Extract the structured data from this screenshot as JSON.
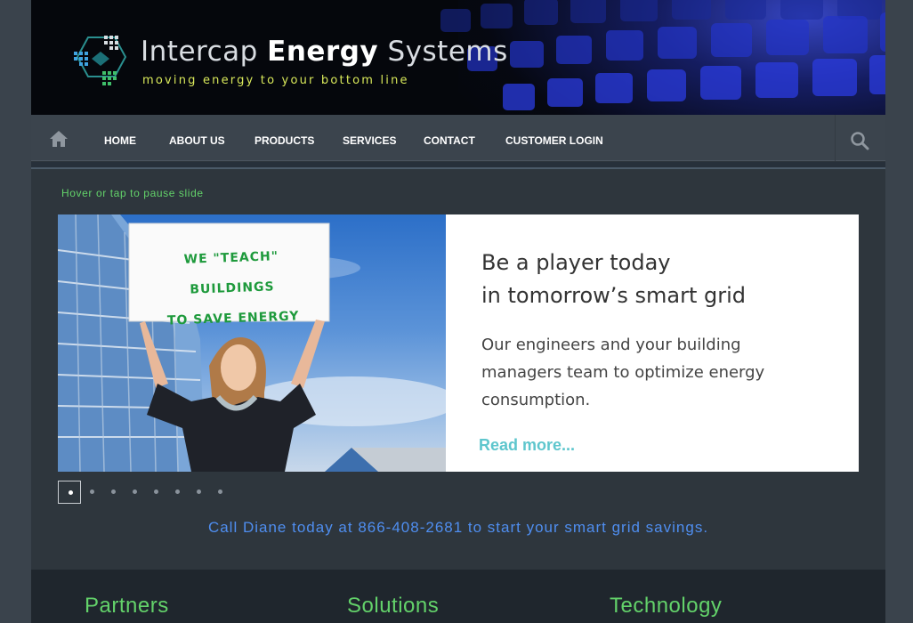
{
  "header": {
    "brand_light": "Intercap",
    "brand_bold": "Energy",
    "brand_end": "Systems",
    "tagline": "moving energy to your bottom line",
    "accent_color": "#d8e85a"
  },
  "nav": {
    "items": [
      {
        "label": "HOME"
      },
      {
        "label": "ABOUT US"
      },
      {
        "label": "PRODUCTS"
      },
      {
        "label": "SERVICES"
      },
      {
        "label": "CONTACT"
      },
      {
        "label": "CUSTOMER LOGIN"
      }
    ],
    "home_icon": "home-icon",
    "search_icon": "search-icon"
  },
  "slider": {
    "hover_tip": "Hover or tap to pause slide",
    "sign_line1": "WE \"TEACH\" BUILDINGS",
    "sign_line2": "TO SAVE ENERGY",
    "heading_line1": "Be a player today",
    "heading_line2": "in tomorrow’s smart grid",
    "body_line1": "Our engineers and your building",
    "body_line2": "managers team to optimize energy",
    "body_line3": "consumption.",
    "read_more": "Read more...",
    "slide_count": 8,
    "active_slide": 1
  },
  "call_to_action": "Call Diane today at 866-408-2681 to start your smart grid savings.",
  "footer": {
    "columns": [
      {
        "title": "Partners"
      },
      {
        "title": "Solutions"
      },
      {
        "title": "Technology"
      }
    ]
  }
}
